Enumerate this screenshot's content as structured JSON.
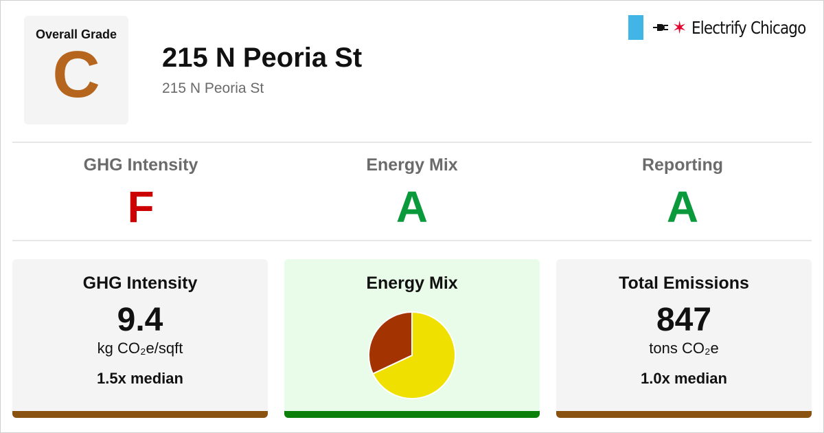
{
  "overall": {
    "label": "Overall Grade",
    "grade": "C",
    "color": "#b5651d"
  },
  "building": {
    "name": "215 N Peoria St",
    "address": "215 N Peoria St"
  },
  "brand": {
    "name": "Electrify Chicago",
    "accent": "#41b6e6",
    "star_color": "#e4002b"
  },
  "sub_grades": [
    {
      "name": "GHG Intensity",
      "grade": "F",
      "color": "#cc0000"
    },
    {
      "name": "Energy Mix",
      "grade": "A",
      "color": "#0a9a3c"
    },
    {
      "name": "Reporting",
      "grade": "A",
      "color": "#0a9a3c"
    }
  ],
  "cards": {
    "ghg": {
      "title": "GHG Intensity",
      "value": "9.4",
      "unit": "kg CO₂e/sqft",
      "median": "1.5x median",
      "bar_color": "#8a5210"
    },
    "energy": {
      "title": "Energy Mix",
      "background": "#e9fbe9",
      "bar_color": "#0a7f0a"
    },
    "emissions": {
      "title": "Total Emissions",
      "value": "847",
      "unit": "tons CO₂e",
      "median": "1.0x median",
      "bar_color": "#8a5210"
    }
  },
  "chart_data": {
    "type": "pie",
    "slices": [
      {
        "value": 68,
        "color": "#f0e000"
      },
      {
        "value": 32,
        "color": "#a33300"
      }
    ]
  }
}
